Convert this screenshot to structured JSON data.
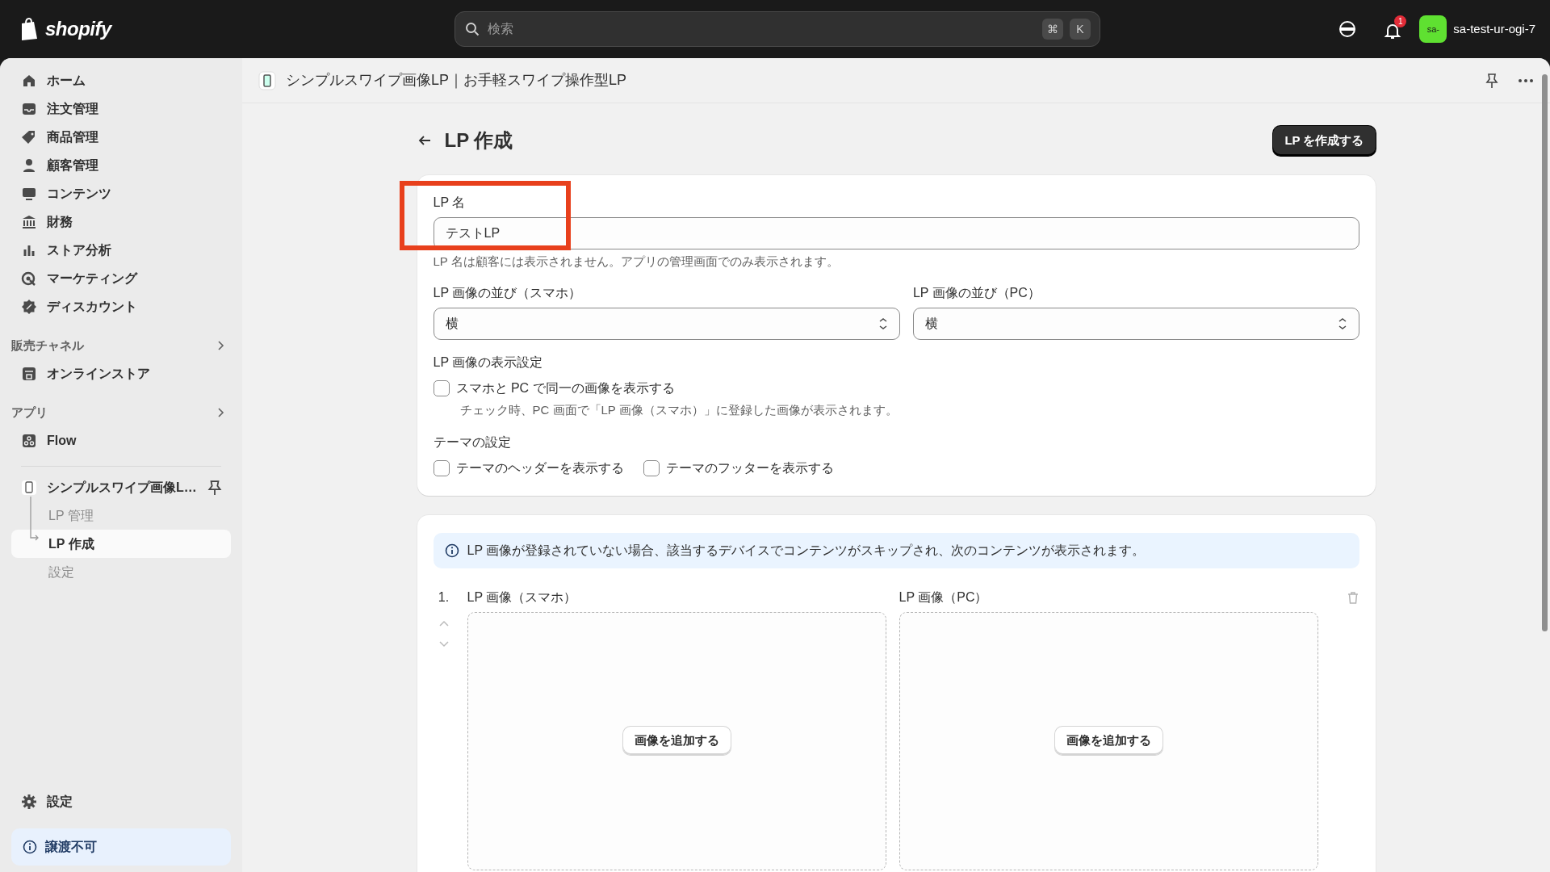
{
  "topbar": {
    "logo": "shopify",
    "search": {
      "placeholder": "検索",
      "shortcut": [
        "⌘",
        "K"
      ]
    },
    "notification_badge": "1",
    "store": {
      "avatar": "sa-",
      "name": "sa-test-ur-ogi-7"
    }
  },
  "sidebar": {
    "items": [
      {
        "label": "ホーム"
      },
      {
        "label": "注文管理"
      },
      {
        "label": "商品管理"
      },
      {
        "label": "顧客管理"
      },
      {
        "label": "コンテンツ"
      },
      {
        "label": "財務"
      },
      {
        "label": "ストア分析"
      },
      {
        "label": "マーケティング"
      },
      {
        "label": "ディスカウント"
      }
    ],
    "sections": [
      {
        "title": "販売チャネル",
        "items": [
          {
            "label": "オンラインストア"
          }
        ]
      },
      {
        "title": "アプリ",
        "items": [
          {
            "label": "Flow"
          }
        ]
      }
    ],
    "app": {
      "label": "シンプルスワイプ画像L…",
      "children": [
        {
          "label": "LP 管理",
          "selected": false
        },
        {
          "label": "LP 作成",
          "selected": true
        },
        {
          "label": "設定",
          "selected": false
        }
      ]
    },
    "footer_item": "設定",
    "notice": "譲渡不可"
  },
  "app_header": {
    "title": "シンプルスワイプ画像LP｜お手軽スワイプ操作型LP"
  },
  "page": {
    "title": "LP 作成",
    "primary_action": "LP を作成する"
  },
  "form": {
    "name_field": {
      "label": "LP 名",
      "value": "テストLP",
      "help": "LP 名は顧客には表示されません。アプリの管理画面でのみ表示されます。",
      "highlighted": true
    },
    "selects": [
      {
        "label": "LP 画像の並び（スマホ）",
        "value": "横"
      },
      {
        "label": "LP 画像の並び（PC）",
        "value": "横"
      }
    ],
    "display_settings": {
      "title": "LP 画像の表示設定",
      "checkboxes": [
        {
          "label": "スマホと PC で同一の画像を表示する",
          "checked": false,
          "help": "チェック時、PC 画面で「LP 画像（スマホ）」に登録した画像が表示されます。"
        }
      ]
    },
    "theme_settings": {
      "title": "テーマの設定",
      "checkboxes": [
        {
          "label": "テーマのヘッダーを表示する",
          "checked": false
        },
        {
          "label": "テーマのフッターを表示する",
          "checked": false
        }
      ]
    }
  },
  "images": {
    "notice": "LP 画像が登録されていない場合、該当するデバイスでコンテンツがスキップされ、次のコンテンツが表示されます。",
    "rows": [
      {
        "number": "1.",
        "slots": [
          {
            "label": "LP 画像（スマホ）",
            "button": "画像を追加する"
          },
          {
            "label": "LP 画像（PC）",
            "button": "画像を追加する"
          }
        ]
      }
    ]
  }
}
